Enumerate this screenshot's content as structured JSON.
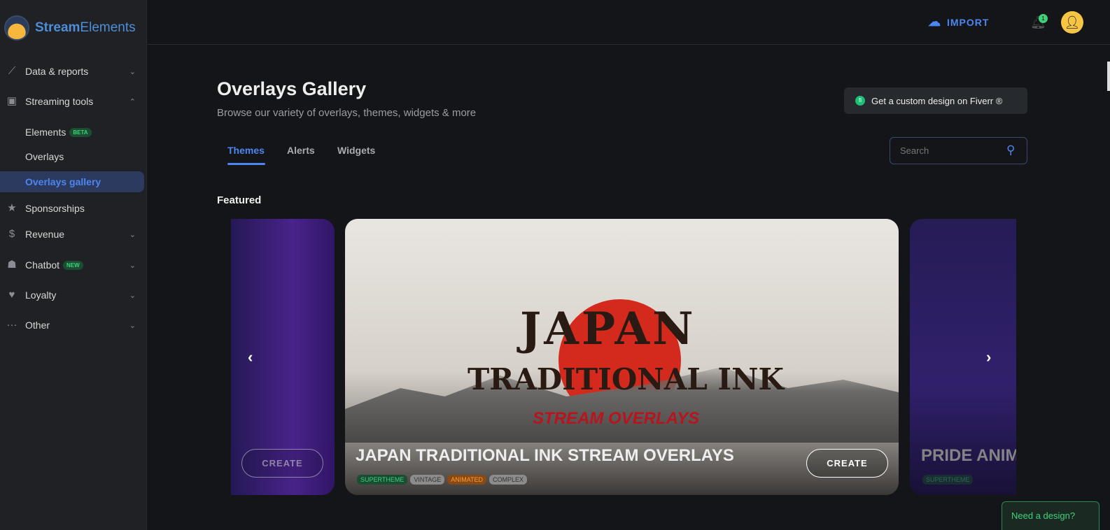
{
  "brand": {
    "name_bold": "Stream",
    "name_rest": "Elements"
  },
  "sidebar": {
    "items": [
      {
        "label": "Data & reports",
        "icon": "chart-icon"
      },
      {
        "label": "Streaming tools",
        "icon": "streaming-icon"
      },
      {
        "label": "Sponsorships",
        "icon": "star-icon"
      },
      {
        "label": "Revenue",
        "icon": "dollar-icon"
      },
      {
        "label": "Chatbot",
        "icon": "robot-icon",
        "badge": "NEW"
      },
      {
        "label": "Loyalty",
        "icon": "loyalty-icon"
      },
      {
        "label": "Other",
        "icon": "more-icon"
      }
    ],
    "sub_items": [
      {
        "label": "Elements",
        "badge": "BETA"
      },
      {
        "label": "Overlays"
      },
      {
        "label": "Overlays gallery"
      }
    ]
  },
  "header": {
    "import_label": "IMPORT",
    "notification_count": "1"
  },
  "page": {
    "title": "Overlays Gallery",
    "subtitle": "Browse our variety of overlays, themes, widgets & more",
    "fiverr_label": "Get a custom design on Fiverr ®",
    "tabs": [
      {
        "label": "Themes"
      },
      {
        "label": "Alerts"
      },
      {
        "label": "Widgets"
      }
    ],
    "search_placeholder": "Search",
    "featured_label": "Featured"
  },
  "carousel": {
    "main": {
      "title": "JAPAN TRADITIONAL INK STREAM OVERLAYS",
      "art_text": [
        "JAPAN",
        "TRADITIONAL INK",
        "STREAM OVERLAYS"
      ],
      "create_label": "CREATE",
      "tags": [
        {
          "label": "SUPERTHEME",
          "bg": "#1b4d32",
          "color": "#3ed17a"
        },
        {
          "label": "VINTAGE",
          "bg": "#8c8c8c",
          "color": "#333"
        },
        {
          "label": "ANIMATED",
          "bg": "#8a4a14",
          "color": "#ff9a3a"
        },
        {
          "label": "COMPLEX",
          "bg": "#8c8c8c",
          "color": "#333"
        }
      ]
    },
    "left": {
      "create_label": "CREATE"
    },
    "right": {
      "title": "PRIDE ANIM",
      "tags": [
        {
          "label": "SUPERTHEME"
        }
      ]
    }
  },
  "help": {
    "label": "Need a design?"
  },
  "colors": {
    "accent": "#4d86f0",
    "green": "#3ed17a"
  }
}
